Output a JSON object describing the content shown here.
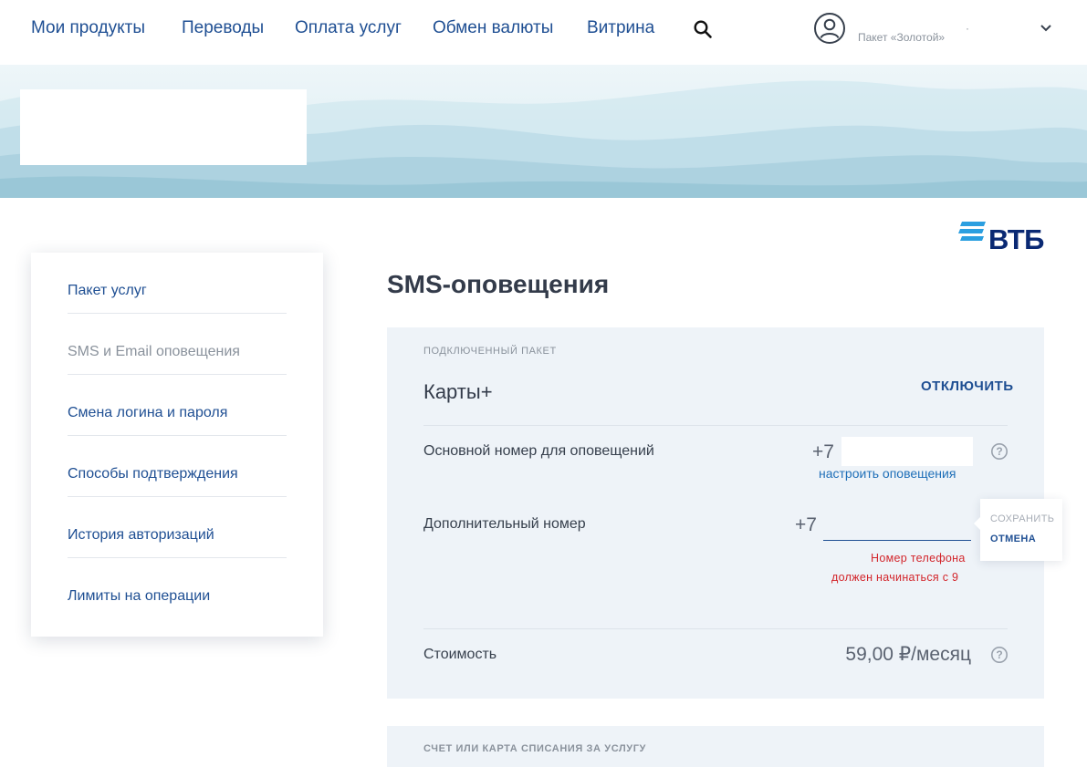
{
  "nav": {
    "items": [
      "Мои продукты",
      "Переводы",
      "Оплата услуг",
      "Обмен валюты",
      "Витрина"
    ],
    "search_icon": "search-icon",
    "user": {
      "avatar_icon": "user-circle-icon",
      "package": "Пакет «Золотой»",
      "name_mark": "·",
      "chevron_icon": "chevron-down-icon"
    }
  },
  "logo": {
    "text": "ВТБ",
    "color": "#0a2973",
    "accent": "#2b9fe0"
  },
  "side_menu": {
    "items": [
      {
        "label": "Пакет услуг",
        "active": false
      },
      {
        "label": "SMS и Email оповещения",
        "active": true
      },
      {
        "label": "Смена логина и пароля",
        "active": false
      },
      {
        "label": "Способы подтверждения",
        "active": false
      },
      {
        "label": "История авторизаций",
        "active": false
      },
      {
        "label": "Лимиты на операции",
        "active": false
      }
    ]
  },
  "main": {
    "title": "SMS-оповещения",
    "package_section": {
      "caption": "ПОДКЛЮЧЕННЫЙ ПАКЕТ",
      "name": "Карты+",
      "disconnect_label": "ОТКЛЮЧИТЬ"
    },
    "primary_number": {
      "label": "Основной номер для оповещений",
      "prefix": "+7",
      "configure_link": "настроить оповещения",
      "help_icon": "question-circle-icon"
    },
    "additional_number": {
      "label": "Дополнительный номер",
      "prefix": "+7",
      "value": "",
      "error_line1": "Номер телефона",
      "error_line2": "должен начинаться с 9",
      "save_label": "СОХРАНИТЬ",
      "cancel_label": "ОТМЕНА"
    },
    "cost": {
      "label": "Стоимость",
      "value": "59,00 ₽/месяц",
      "help_icon": "question-circle-icon"
    },
    "account_section": {
      "caption": "СЧЕТ ИЛИ КАРТА СПИСАНИЯ ЗА УСЛУГУ"
    }
  },
  "colors": {
    "link": "#1f4f93",
    "error": "#d3262c",
    "panel_bg": "#eef3f8"
  }
}
